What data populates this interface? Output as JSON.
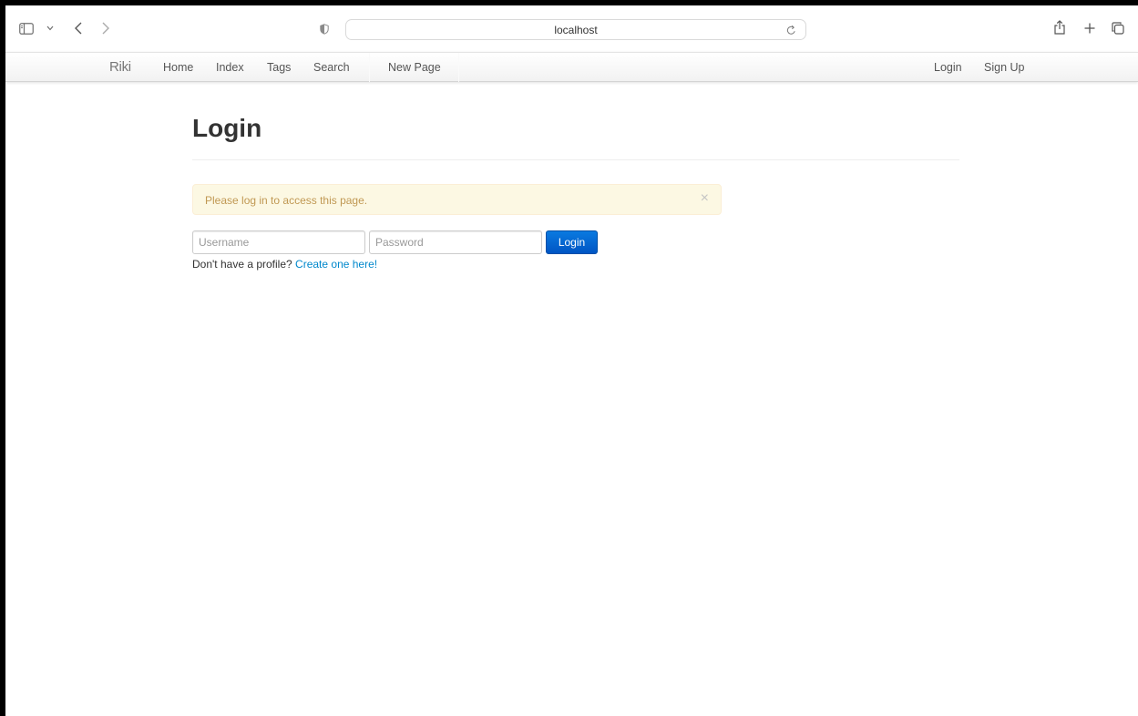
{
  "browser": {
    "address": "localhost",
    "icons": {
      "sidebar": "sidebar-icon",
      "sidebar_menu": "chevron-down-icon",
      "back": "chevron-left-icon",
      "forward": "chevron-right-icon",
      "privacy": "shield-icon",
      "reload": "reload-icon",
      "share": "share-icon",
      "new_tab": "plus-icon",
      "tabs": "tabs-overview-icon"
    }
  },
  "navbar": {
    "brand": "Riki",
    "links": [
      "Home",
      "Index",
      "Tags",
      "Search"
    ],
    "new_page": "New Page",
    "login": "Login",
    "signup": "Sign Up"
  },
  "page": {
    "title": "Login",
    "alert": {
      "message": "Please log in to access this page.",
      "close": "×"
    },
    "form": {
      "username_placeholder": "Username",
      "password_placeholder": "Password",
      "username_value": "",
      "password_value": "",
      "submit_label": "Login"
    },
    "signup_prompt": "Don't have a profile?",
    "signup_link": "Create one here!"
  },
  "colors": {
    "alert_bg": "#fcf8e3",
    "alert_text": "#c09853",
    "primary_button": "#0066d6",
    "link": "#0088cc"
  }
}
